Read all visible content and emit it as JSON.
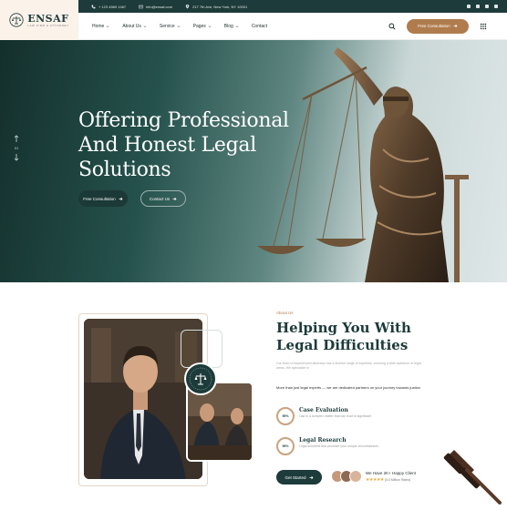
{
  "brand": {
    "name": "ENSAF",
    "tagline": "LAW FIRM & ATTORNEY"
  },
  "topbar": {
    "phone": "+ 123 4569 1467",
    "email": "info@ensaf.com",
    "address": "217 7th Ave, New York, NY 10001"
  },
  "nav": {
    "items": [
      "Home",
      "About Us",
      "Service",
      "Pages",
      "Blog",
      "Contact"
    ],
    "cta": "Free Consultation"
  },
  "hero": {
    "title_lines": [
      "Offering Professional",
      "And Honest Legal",
      "Solutions"
    ],
    "btn_primary": "Free Consultation",
    "btn_secondary": "Contact Us",
    "slide_counter": "01"
  },
  "about": {
    "eyebrow": "About Us",
    "title_lines": [
      "Helping You With",
      "Legal Difficulties"
    ],
    "description": "Our team of experienced attorneys has a diverse range of expertise, covering a wide spectrum of legal areas. We specialize in",
    "lead": "More than just legal experts — we are dedicated partners on your journey towards justice.",
    "features": [
      {
        "percent": "95%",
        "title": "Case Evaluation",
        "text": "Law is a complex matter that can lead to significant"
      },
      {
        "percent": "95%",
        "title": "Legal Research",
        "text": "Legal solutions that prioritize your unique circumstances"
      }
    ],
    "cta": "Get Started",
    "clients_label": "We Have 2K+ Happy Client",
    "rating_text": "(5.0 Million Rated)"
  },
  "colors": {
    "primary": "#1d3b3a",
    "accent": "#b07c4e",
    "logo_bg": "#fbf2ea"
  }
}
